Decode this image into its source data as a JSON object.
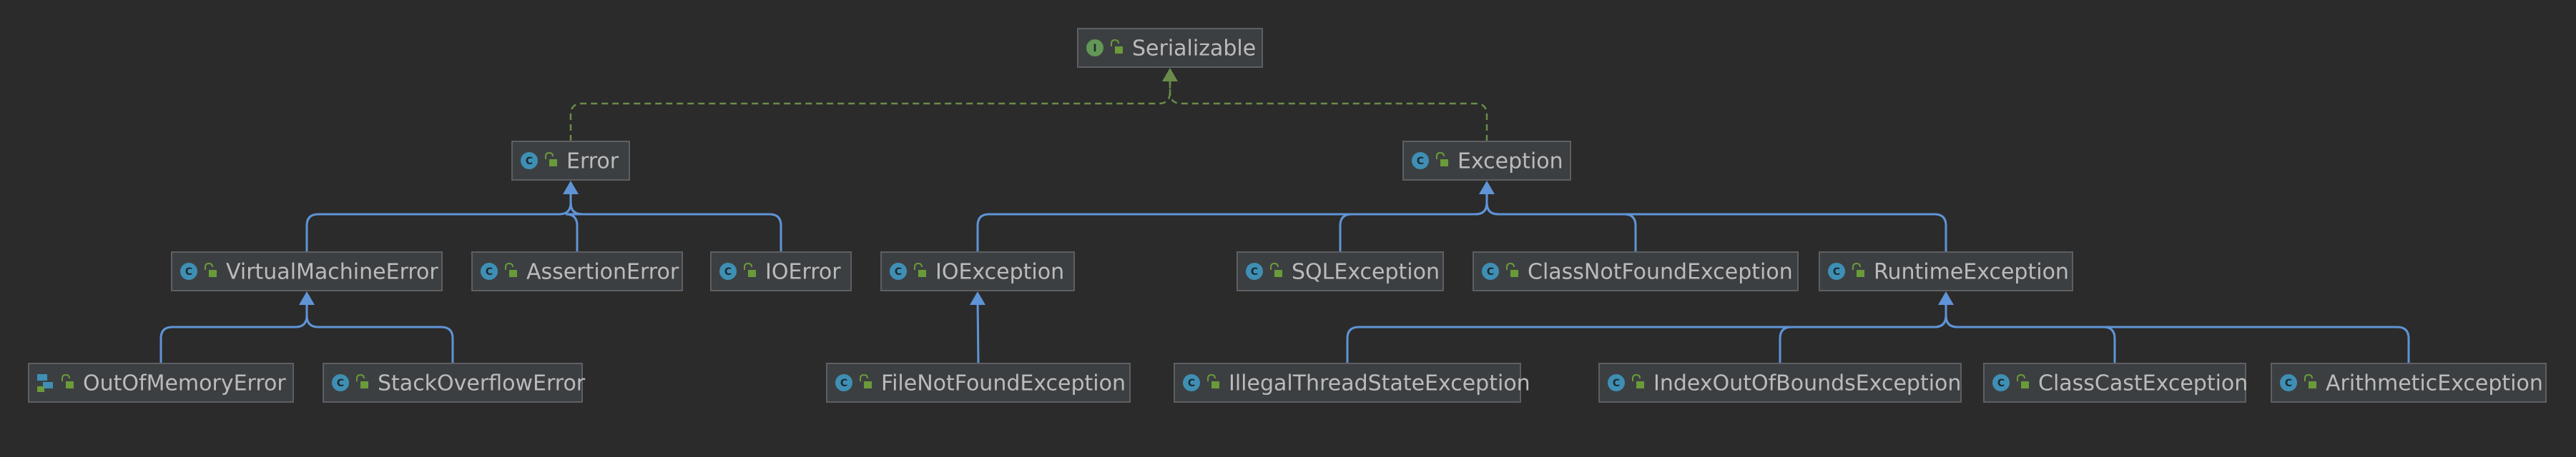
{
  "nodes": [
    {
      "id": "serializable",
      "label": "Serializable",
      "kind": "interface",
      "badge_color": "#629755",
      "badge_letter": "I"
    },
    {
      "id": "error",
      "label": "Error",
      "kind": "class",
      "badge_color": "#3f8fb5",
      "badge_letter": "C"
    },
    {
      "id": "exception",
      "label": "Exception",
      "kind": "class",
      "badge_color": "#3f8fb5",
      "badge_letter": "C"
    },
    {
      "id": "virtualmachineerror",
      "label": "VirtualMachineError",
      "kind": "abstract-class",
      "badge_color": "#3f8fb5",
      "badge_letter": "C"
    },
    {
      "id": "assertionerror",
      "label": "AssertionError",
      "kind": "class",
      "badge_color": "#3f8fb5",
      "badge_letter": "C"
    },
    {
      "id": "ioerror",
      "label": "IOError",
      "kind": "class",
      "badge_color": "#3f8fb5",
      "badge_letter": "C"
    },
    {
      "id": "ioexception",
      "label": "IOException",
      "kind": "class",
      "badge_color": "#3f8fb5",
      "badge_letter": "C"
    },
    {
      "id": "sqlexception",
      "label": "SQLException",
      "kind": "class",
      "badge_color": "#3f8fb5",
      "badge_letter": "C"
    },
    {
      "id": "classnotfoundexception",
      "label": "ClassNotFoundException",
      "kind": "class",
      "badge_color": "#3f8fb5",
      "badge_letter": "C"
    },
    {
      "id": "runtimeexception",
      "label": "RuntimeException",
      "kind": "class",
      "badge_color": "#3f8fb5",
      "badge_letter": "C"
    },
    {
      "id": "outofmemoryerror",
      "label": "OutOfMemoryError",
      "kind": "class-alt",
      "badge_color": "#3f8fb5",
      "badge_letter": "C"
    },
    {
      "id": "stackoverflowerror",
      "label": "StackOverflowError",
      "kind": "class",
      "badge_color": "#3f8fb5",
      "badge_letter": "C"
    },
    {
      "id": "filenotfoundexception",
      "label": "FileNotFoundException",
      "kind": "class",
      "badge_color": "#3f8fb5",
      "badge_letter": "C"
    },
    {
      "id": "illegalthreadstateexception",
      "label": "IllegalThreadStateException",
      "kind": "class",
      "badge_color": "#3f8fb5",
      "badge_letter": "C"
    },
    {
      "id": "indexoutofboundsexception",
      "label": "IndexOutOfBoundsException",
      "kind": "class",
      "badge_color": "#3f8fb5",
      "badge_letter": "C"
    },
    {
      "id": "classcastexception",
      "label": "ClassCastException",
      "kind": "class",
      "badge_color": "#3f8fb5",
      "badge_letter": "C"
    },
    {
      "id": "arithmeticexception",
      "label": "ArithmeticException",
      "kind": "class",
      "badge_color": "#3f8fb5",
      "badge_letter": "C"
    }
  ],
  "edges": [
    {
      "from": "error",
      "to": "serializable",
      "type": "implements"
    },
    {
      "from": "exception",
      "to": "serializable",
      "type": "implements"
    },
    {
      "from": "virtualmachineerror",
      "to": "error",
      "type": "extends"
    },
    {
      "from": "assertionerror",
      "to": "error",
      "type": "extends"
    },
    {
      "from": "ioerror",
      "to": "error",
      "type": "extends"
    },
    {
      "from": "ioexception",
      "to": "exception",
      "type": "extends"
    },
    {
      "from": "sqlexception",
      "to": "exception",
      "type": "extends"
    },
    {
      "from": "classnotfoundexception",
      "to": "exception",
      "type": "extends"
    },
    {
      "from": "runtimeexception",
      "to": "exception",
      "type": "extends"
    },
    {
      "from": "outofmemoryerror",
      "to": "virtualmachineerror",
      "type": "extends"
    },
    {
      "from": "stackoverflowerror",
      "to": "virtualmachineerror",
      "type": "extends"
    },
    {
      "from": "filenotfoundexception",
      "to": "ioexception",
      "type": "extends"
    },
    {
      "from": "illegalthreadstateexception",
      "to": "runtimeexception",
      "type": "extends"
    },
    {
      "from": "indexoutofboundsexception",
      "to": "runtimeexception",
      "type": "extends"
    },
    {
      "from": "classcastexception",
      "to": "runtimeexception",
      "type": "extends"
    },
    {
      "from": "arithmeticexception",
      "to": "runtimeexception",
      "type": "extends"
    }
  ],
  "colors": {
    "background": "#2b2b2b",
    "node_fill": "#3c3f41",
    "node_border": "#5d5f62",
    "label_text": "#bbbbbb",
    "extends_edge": "#5f94d6",
    "implements_edge": "#6a8c4a",
    "lock_icon": "#6a9a3a"
  }
}
